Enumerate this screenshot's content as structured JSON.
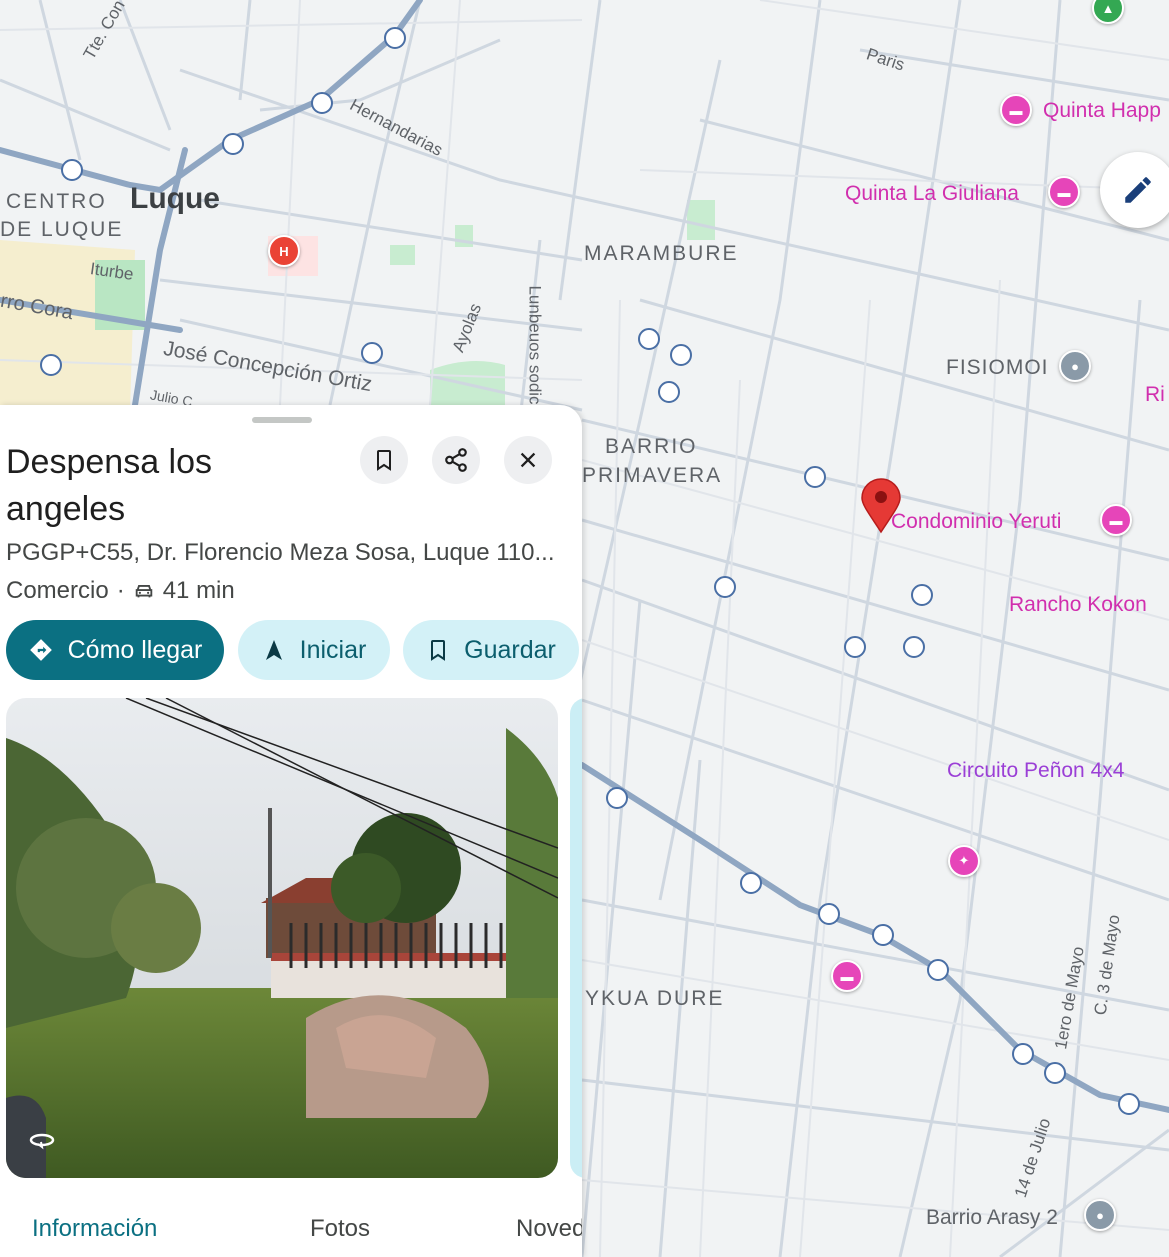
{
  "map": {
    "city_label": "Luque",
    "areas": [
      "CENTRO",
      "DE LUQUE",
      "MARAMBURE",
      "BARRIO",
      "PRIMAVERA",
      "YKUA DURE"
    ],
    "streets": [
      "Tte. Con",
      "Hernandarias",
      "Iturbe",
      "rro Cora",
      "José Concepción Ortiz",
      "Julio C",
      "Ayolas",
      "Lunbeuos sodic",
      "Paris",
      "1ero de Mayo",
      "C. 3 de Mayo",
      "14 de Julio"
    ],
    "places": {
      "quinta_happ": "Quinta Happ",
      "quinta_giuliana": "Quinta La Giuliana",
      "fisiomoi": "FISIOMOI",
      "ri": "Ri",
      "condominio": "Condominio Yeruti",
      "rancho": "Rancho Kokon",
      "circuito": "Circuito Peñon 4x4",
      "barrio_arasy": "Barrio Arasy 2"
    },
    "hospital_letter": "H",
    "colors": {
      "poi": "#d12fae",
      "selected_pin": "#e53935",
      "transit": "#4a6fa5"
    }
  },
  "place": {
    "title": "Despensa los angeles",
    "address": "PGGP+C55, Dr. Florencio Meza Sosa, Luque 110...",
    "category": "Comercio",
    "separator": "·",
    "travel_time": "41 min",
    "actions": {
      "directions": "Cómo llegar",
      "start": "Iniciar",
      "save": "Guardar"
    },
    "icons": {
      "save": "bookmark-icon",
      "share": "share-icon",
      "close": "close-icon",
      "car": "car-icon",
      "edit": "pencil-icon",
      "street_view": "360-view-icon"
    },
    "tabs": [
      "Información",
      "Fotos",
      "Noved"
    ],
    "active_tab": "Información",
    "accent": "#0b7082"
  }
}
